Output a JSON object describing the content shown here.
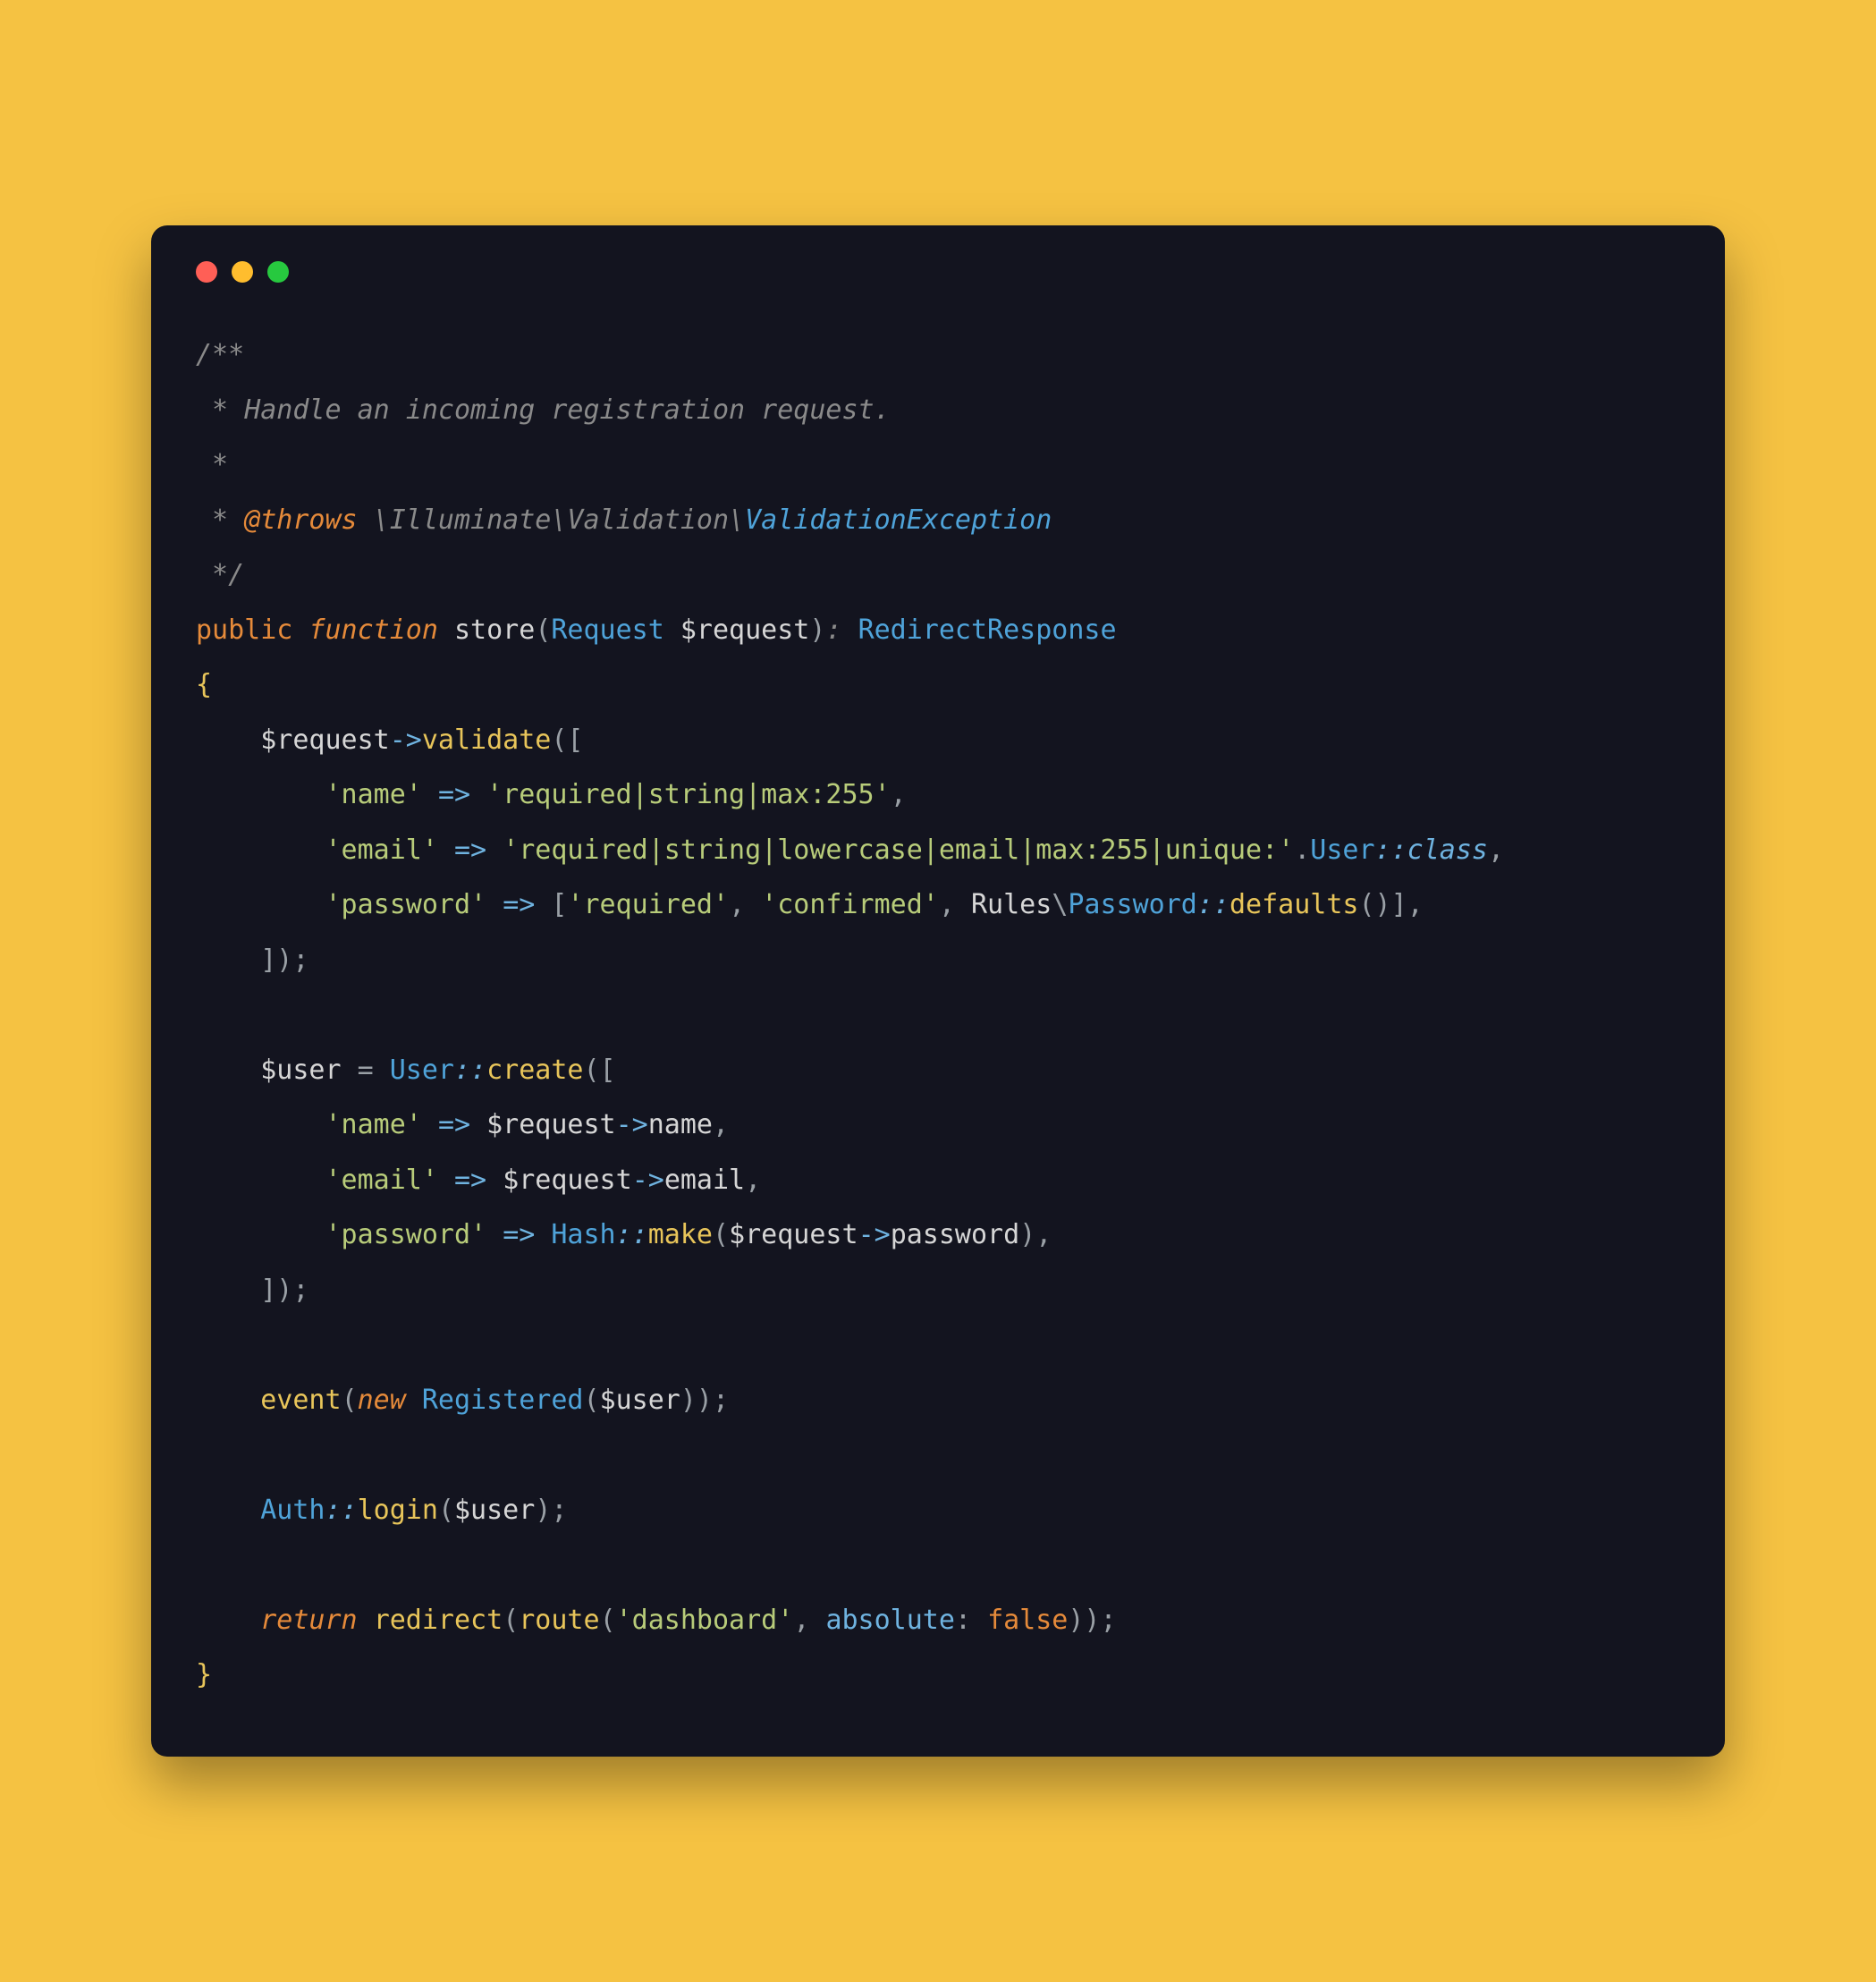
{
  "code": {
    "l1": "/**",
    "l2_prefix": " * ",
    "l2_text": "Handle an incoming registration request.",
    "l3": " *",
    "l4_prefix": " * ",
    "l4_tag": "@throws",
    "l4_ns": " \\Illuminate\\Validation\\",
    "l4_exc": "ValidationException",
    "l5": " */",
    "l6_public": "public",
    "l6_function": "function",
    "l6_name": "store",
    "l6_reqtype": "Request",
    "l6_param": "$request",
    "l6_ret": "RedirectResponse",
    "l7_brace": "{",
    "l8_var": "$request",
    "l8_arrow": "->",
    "l8_method": "validate",
    "l9_key": "'name'",
    "l9_arrow": "=>",
    "l9_val": "'required|string|max:255'",
    "l10_key": "'email'",
    "l10_val": "'required|string|lowercase|email|max:255|unique:'",
    "l10_user": "User",
    "l10_class": "class",
    "l11_key": "'password'",
    "l11_req": "'required'",
    "l11_conf": "'confirmed'",
    "l11_rules": "Rules",
    "l11_pw": "Password",
    "l11_defaults": "defaults",
    "l13_user": "$user",
    "l13_User": "User",
    "l13_create": "create",
    "l14_key": "'name'",
    "l14_req": "$request",
    "l14_name": "name",
    "l15_key": "'email'",
    "l15_req": "$request",
    "l15_email": "email",
    "l16_key": "'password'",
    "l16_hash": "Hash",
    "l16_make": "make",
    "l16_req": "$request",
    "l16_pw": "password",
    "l18_event": "event",
    "l18_new": "new",
    "l18_reg": "Registered",
    "l18_user": "$user",
    "l19_auth": "Auth",
    "l19_login": "login",
    "l19_user": "$user",
    "l20_return": "return",
    "l20_redirect": "redirect",
    "l20_route": "route",
    "l20_dash": "'dashboard'",
    "l20_abs": "absolute",
    "l20_false": "false",
    "l21_brace": "}"
  }
}
